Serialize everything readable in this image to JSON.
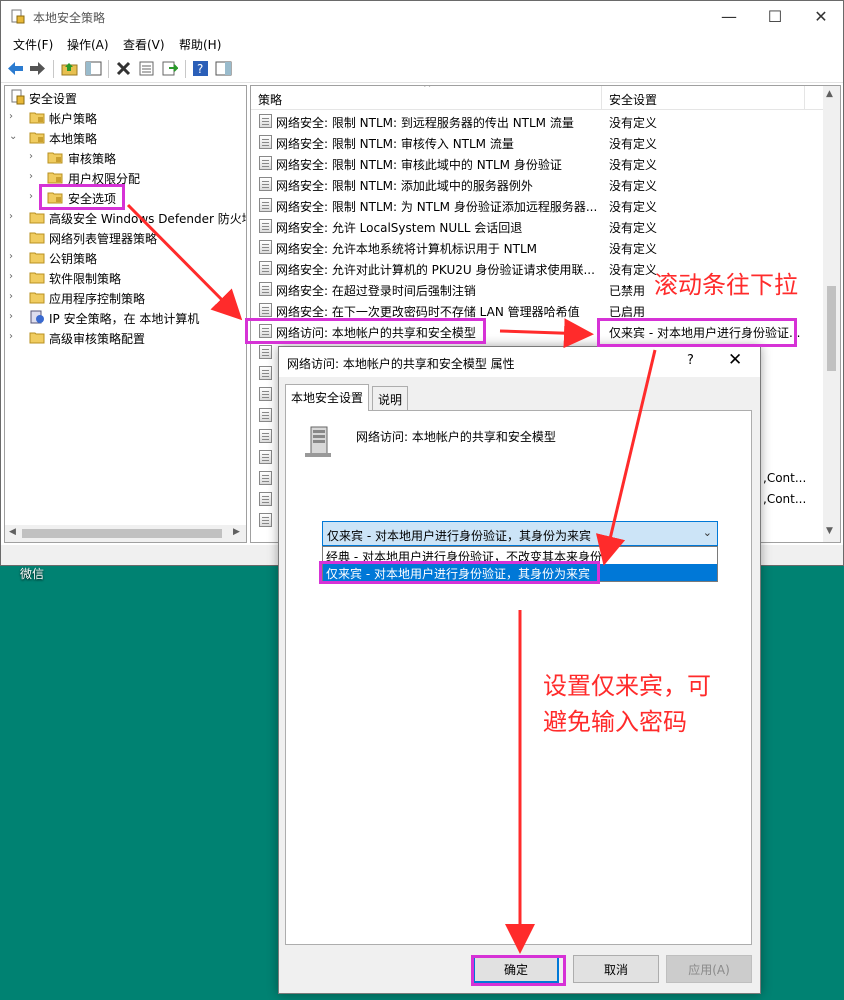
{
  "window": {
    "title": "本地安全策略",
    "controls": {
      "minimize": "—",
      "maximize": "☐",
      "close": "✕"
    }
  },
  "menu": [
    "文件(F)",
    "操作(A)",
    "查看(V)",
    "帮助(H)"
  ],
  "tree": {
    "items": [
      {
        "label": "安全设置",
        "level": 0,
        "expanded": true
      },
      {
        "label": "帐户策略",
        "level": 1,
        "expanded": false
      },
      {
        "label": "本地策略",
        "level": 1,
        "expanded": true
      },
      {
        "label": "审核策略",
        "level": 2,
        "expanded": false
      },
      {
        "label": "用户权限分配",
        "level": 2,
        "expanded": false
      },
      {
        "label": "安全选项",
        "level": 2,
        "selected": true
      },
      {
        "label": "高级安全 Windows Defender 防火墙",
        "level": 1,
        "expanded": false
      },
      {
        "label": "网络列表管理器策略",
        "level": 1
      },
      {
        "label": "公钥策略",
        "level": 1,
        "expanded": false
      },
      {
        "label": "软件限制策略",
        "level": 1,
        "expanded": false
      },
      {
        "label": "应用程序控制策略",
        "level": 1,
        "expanded": false
      },
      {
        "label": "IP 安全策略，在 本地计算机",
        "level": 1,
        "expanded": false
      },
      {
        "label": "高级审核策略配置",
        "level": 1,
        "expanded": false
      }
    ]
  },
  "list": {
    "columns": [
      "策略",
      "安全设置"
    ],
    "rows": [
      {
        "policy": "网络安全: 限制 NTLM: 到远程服务器的传出 NTLM 流量",
        "setting": "没有定义"
      },
      {
        "policy": "网络安全: 限制 NTLM: 审核传入 NTLM 流量",
        "setting": "没有定义"
      },
      {
        "policy": "网络安全: 限制 NTLM: 审核此域中的 NTLM 身份验证",
        "setting": "没有定义"
      },
      {
        "policy": "网络安全: 限制 NTLM: 添加此域中的服务器例外",
        "setting": "没有定义"
      },
      {
        "policy": "网络安全: 限制 NTLM: 为 NTLM 身份验证添加远程服务器...",
        "setting": "没有定义"
      },
      {
        "policy": "网络安全: 允许 LocalSystem NULL 会话回退",
        "setting": "没有定义"
      },
      {
        "policy": "网络安全: 允许本地系统将计算机标识用于 NTLM",
        "setting": "没有定义"
      },
      {
        "policy": "网络安全: 允许对此计算机的 PKU2U 身份验证请求使用联...",
        "setting": "没有定义"
      },
      {
        "policy": "网络安全: 在超过登录时间后强制注销",
        "setting": "已禁用"
      },
      {
        "policy": "网络安全: 在下一次更改密码时不存储 LAN 管理器哈希值",
        "setting": "已启用"
      },
      {
        "policy": "网络访问: 本地帐户的共享和安全模型",
        "setting": "仅来宾 - 对本地用户进行身份验证..."
      }
    ],
    "partial_rows": [
      {
        "setting": ",Cont..."
      },
      {
        "setting": ",Cont..."
      }
    ]
  },
  "desktop": {
    "icon_label": "微信"
  },
  "dialog": {
    "title": "网络访问: 本地帐户的共享和安全模型 属性",
    "help": "?",
    "close": "✕",
    "tabs": [
      "本地安全设置",
      "说明"
    ],
    "heading": "网络访问: 本地帐户的共享和安全模型",
    "combo_value": "仅来宾 - 对本地用户进行身份验证，其身份为来宾",
    "options": [
      "经典 - 对本地用户进行身份验证，不改变其本来身份",
      "仅来宾 - 对本地用户进行身份验证，其身份为来宾"
    ],
    "selected_option": 1,
    "buttons": {
      "ok": "确定",
      "cancel": "取消",
      "apply": "应用(A)"
    }
  },
  "annotations": {
    "scrollbar_note": "滚动条往下拉",
    "guest_note_line1": "设置仅来宾，可",
    "guest_note_line2": "避免输入密码",
    "highlight_color": "#d632d6",
    "arrow_color": "#ff2b2b"
  },
  "colors": {
    "desktop": "#008272",
    "selection": "#0078d7"
  }
}
